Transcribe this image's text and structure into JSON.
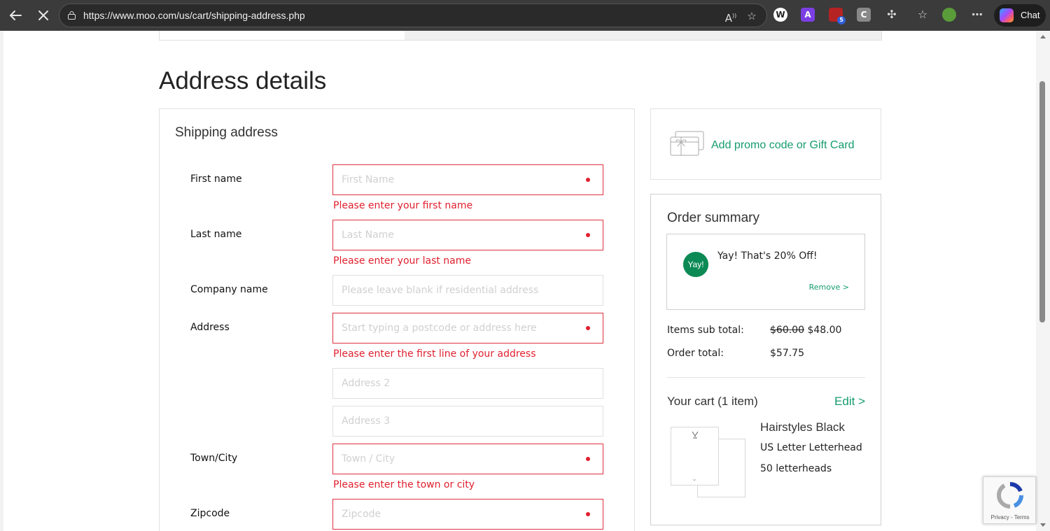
{
  "browser": {
    "url": "https://www.moo.com/us/cart/shipping-address.php",
    "chat_label": "Chat",
    "extension_labels": [
      "A",
      "C"
    ],
    "extension_badge": "5"
  },
  "page": {
    "title": "Address details"
  },
  "shipping": {
    "title": "Shipping address",
    "fields": {
      "first_name": {
        "label": "First name",
        "placeholder": "First Name",
        "error": "Please enter your first name"
      },
      "last_name": {
        "label": "Last name",
        "placeholder": "Last Name",
        "error": "Please enter your last name"
      },
      "company": {
        "label": "Company name",
        "placeholder": "Please leave blank if residential address"
      },
      "address": {
        "label": "Address",
        "placeholder": "Start typing a postcode or address here",
        "error": "Please enter the first line of your address"
      },
      "address2": {
        "placeholder": "Address 2"
      },
      "address3": {
        "placeholder": "Address 3"
      },
      "town": {
        "label": "Town/City",
        "placeholder": "Town / City",
        "error": "Please enter the town or city"
      },
      "zip": {
        "label": "Zipcode",
        "placeholder": "Zipcode"
      }
    }
  },
  "promo": {
    "link": "Add promo code or Gift Card"
  },
  "summary": {
    "title": "Order summary",
    "badge": "Yay!",
    "discount_message": "Yay! That's 20% Off!",
    "remove_label": "Remove >",
    "items_subtotal_label": "Items sub total:",
    "items_subtotal_original": "$60.00",
    "items_subtotal": "$48.00",
    "order_total_label": "Order total:",
    "order_total": "$57.75",
    "cart_title": "Your cart (1 item)",
    "edit_label": "Edit >",
    "product": {
      "name": "Hairstyles Black",
      "format": "US Letter Letterhead",
      "quantity": "50 letterheads"
    }
  },
  "recaptcha": {
    "text": "Privacy - Terms"
  },
  "colors": {
    "brand_green": "#159c6f",
    "error_red": "#e0202e"
  }
}
